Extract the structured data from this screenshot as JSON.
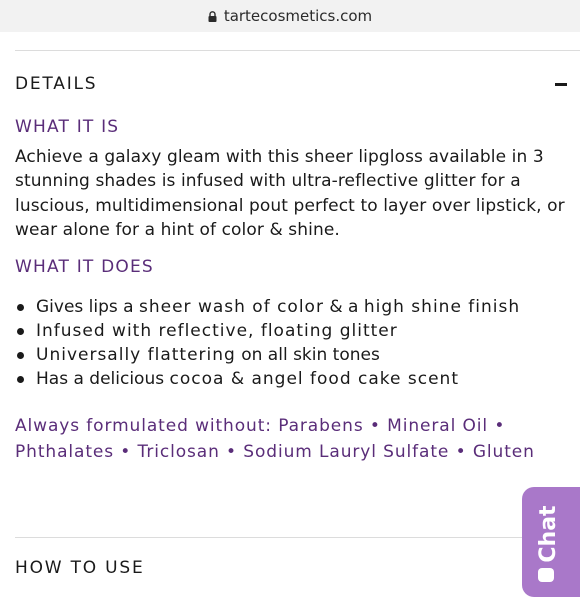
{
  "browser": {
    "url": "tartecosmetics.com"
  },
  "details": {
    "title": "DETAILS",
    "what_it_is": {
      "heading": "WHAT IT IS",
      "text": "Achieve a galaxy gleam with this sheer lipgloss available in 3 stunning shades is infused with ultra-reflective glitter for a luscious, multidimensional pout perfect to layer over lipstick, or wear alone for a hint of color & shine."
    },
    "what_it_does": {
      "heading": "WHAT IT DOES",
      "items": [
        {
          "a": "Gives lips a ",
          "b": "sheer wash of color",
          "c": " & a ",
          "d": "high shine finish"
        },
        {
          "a": "",
          "b": "Infused with reflective, floating glitter",
          "c": "",
          "d": ""
        },
        {
          "a": "",
          "b": "Universally flattering",
          "c": " on all skin tones",
          "d": ""
        },
        {
          "a": "Has a delicious ",
          "b": "cocoa & angel food cake scent",
          "c": "",
          "d": ""
        }
      ]
    },
    "formulated_without": "Always formulated without: Parabens • Mineral Oil • Phthalates • Triclosan • Sodium Lauryl Sulfate • Gluten"
  },
  "how_to_use": {
    "title": "HOW TO USE"
  },
  "chat": {
    "label": "Chat"
  },
  "colors": {
    "accent": "#5a2d79",
    "chat_bg": "#a978c9",
    "text": "#1a1a1a"
  },
  "icons": {
    "lock": "lock-icon",
    "collapse": "minus-icon",
    "chat": "chat-bubble-icon"
  }
}
